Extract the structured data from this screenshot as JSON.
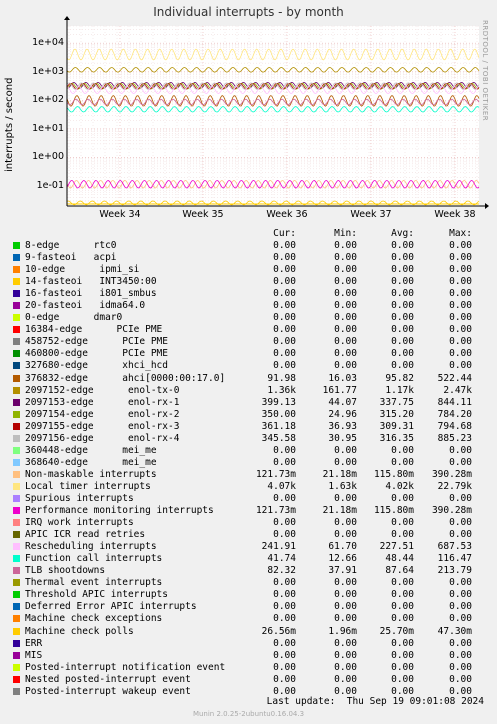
{
  "title": "Individual interrupts - by month",
  "side_label": "RRDTOOL / TOBI OETIKER",
  "footer": "Munin 2.0.25-2ubuntu0.16.04.3",
  "last_update": "Last update:  Thu Sep 19 09:01:08 2024",
  "columns": [
    "Cur:",
    "Min:",
    "Avg:",
    "Max:"
  ],
  "chart_data": {
    "type": "line",
    "ylabel": "interrupts / second",
    "yscale": "log",
    "ylim": [
      0.02,
      40000
    ],
    "yticks": [
      "1e+04",
      "1e+03",
      "1e+02",
      "1e+01",
      "1e+00",
      "1e-01"
    ],
    "x": [
      "Week 34",
      "Week 35",
      "Week 36",
      "Week 37",
      "Week 38"
    ],
    "grid": true,
    "series": [
      {
        "name": "8-edge      rtc0",
        "color": "#00cc00",
        "cur": "0.00",
        "min": "0.00",
        "avg": "0.00",
        "max": "0.00"
      },
      {
        "name": "9-fasteoi   acpi",
        "color": "#0066b3",
        "cur": "0.00",
        "min": "0.00",
        "avg": "0.00",
        "max": "0.00"
      },
      {
        "name": "10-edge      ipmi_si",
        "color": "#ff8000",
        "cur": "0.00",
        "min": "0.00",
        "avg": "0.00",
        "max": "0.00"
      },
      {
        "name": "14-fasteoi   INT3450:00",
        "color": "#ffcc00",
        "cur": "0.00",
        "min": "0.00",
        "avg": "0.00",
        "max": "0.00"
      },
      {
        "name": "16-fasteoi   i801_smbus",
        "color": "#330099",
        "cur": "0.00",
        "min": "0.00",
        "avg": "0.00",
        "max": "0.00"
      },
      {
        "name": "20-fasteoi   idma64.0",
        "color": "#990099",
        "cur": "0.00",
        "min": "0.00",
        "avg": "0.00",
        "max": "0.00"
      },
      {
        "name": "0-edge      dmar0",
        "color": "#ccff00",
        "cur": "0.00",
        "min": "0.00",
        "avg": "0.00",
        "max": "0.00"
      },
      {
        "name": "16384-edge      PCIe PME",
        "color": "#ff0000",
        "cur": "0.00",
        "min": "0.00",
        "avg": "0.00",
        "max": "0.00"
      },
      {
        "name": "458752-edge      PCIe PME",
        "color": "#808080",
        "cur": "0.00",
        "min": "0.00",
        "avg": "0.00",
        "max": "0.00"
      },
      {
        "name": "460800-edge      PCIe PME",
        "color": "#008f00",
        "cur": "0.00",
        "min": "0.00",
        "avg": "0.00",
        "max": "0.00"
      },
      {
        "name": "327680-edge      xhci_hcd",
        "color": "#00487d",
        "cur": "0.00",
        "min": "0.00",
        "avg": "0.00",
        "max": "0.00"
      },
      {
        "name": "376832-edge      ahci[0000:00:17.0]",
        "color": "#b35a00",
        "cur": "91.98",
        "min": "16.03",
        "avg": "95.82",
        "max": "522.44"
      },
      {
        "name": "2097152-edge      enol-tx-0",
        "color": "#b38f00",
        "cur": "1.36k",
        "min": "161.77",
        "avg": "1.17k",
        "max": "2.47k"
      },
      {
        "name": "2097153-edge      enol-rx-1",
        "color": "#6b006b",
        "cur": "399.13",
        "min": "44.07",
        "avg": "337.75",
        "max": "844.11"
      },
      {
        "name": "2097154-edge      enol-rx-2",
        "color": "#8fb300",
        "cur": "350.00",
        "min": "24.96",
        "avg": "315.20",
        "max": "784.20"
      },
      {
        "name": "2097155-edge      enol-rx-3",
        "color": "#b30000",
        "cur": "361.18",
        "min": "36.93",
        "avg": "309.31",
        "max": "794.68"
      },
      {
        "name": "2097156-edge      enol-rx-4",
        "color": "#bebebe",
        "cur": "345.58",
        "min": "30.95",
        "avg": "316.35",
        "max": "885.23"
      },
      {
        "name": "360448-edge      mei_me",
        "color": "#80ff80",
        "cur": "0.00",
        "min": "0.00",
        "avg": "0.00",
        "max": "0.00"
      },
      {
        "name": "368640-edge      mei_me",
        "color": "#80c9ff",
        "cur": "0.00",
        "min": "0.00",
        "avg": "0.00",
        "max": "0.00"
      },
      {
        "name": "Non-maskable interrupts",
        "color": "#ffc080",
        "cur": "121.73m",
        "min": "21.18m",
        "avg": "115.80m",
        "max": "390.28m"
      },
      {
        "name": "Local timer interrupts",
        "color": "#ffe680",
        "cur": "4.07k",
        "min": "1.63k",
        "avg": "4.02k",
        "max": "22.79k"
      },
      {
        "name": "Spurious interrupts",
        "color": "#aa80ff",
        "cur": "0.00",
        "min": "0.00",
        "avg": "0.00",
        "max": "0.00"
      },
      {
        "name": "Performance monitoring interrupts",
        "color": "#ee00cc",
        "cur": "121.73m",
        "min": "21.18m",
        "avg": "115.80m",
        "max": "390.28m"
      },
      {
        "name": "IRQ work interrupts",
        "color": "#ff8080",
        "cur": "0.00",
        "min": "0.00",
        "avg": "0.00",
        "max": "0.00"
      },
      {
        "name": "APIC ICR read retries",
        "color": "#666600",
        "cur": "0.00",
        "min": "0.00",
        "avg": "0.00",
        "max": "0.00"
      },
      {
        "name": "Rescheduling interrupts",
        "color": "#ffbfff",
        "cur": "241.91",
        "min": "61.70",
        "avg": "227.51",
        "max": "687.53"
      },
      {
        "name": "Function call interrupts",
        "color": "#00ffcc",
        "cur": "41.74",
        "min": "12.66",
        "avg": "48.44",
        "max": "116.47"
      },
      {
        "name": "TLB shootdowns",
        "color": "#cc6699",
        "cur": "82.32",
        "min": "37.91",
        "avg": "87.64",
        "max": "213.79"
      },
      {
        "name": "Thermal event interrupts",
        "color": "#999900",
        "cur": "0.00",
        "min": "0.00",
        "avg": "0.00",
        "max": "0.00"
      },
      {
        "name": "Threshold APIC interrupts",
        "color": "#00cc00",
        "cur": "0.00",
        "min": "0.00",
        "avg": "0.00",
        "max": "0.00"
      },
      {
        "name": "Deferred Error APIC interrupts",
        "color": "#0066b3",
        "cur": "0.00",
        "min": "0.00",
        "avg": "0.00",
        "max": "0.00"
      },
      {
        "name": "Machine check exceptions",
        "color": "#ff8000",
        "cur": "0.00",
        "min": "0.00",
        "avg": "0.00",
        "max": "0.00"
      },
      {
        "name": "Machine check polls",
        "color": "#ffcc00",
        "cur": "26.56m",
        "min": "1.96m",
        "avg": "25.70m",
        "max": "47.30m"
      },
      {
        "name": "ERR",
        "color": "#330099",
        "cur": "0.00",
        "min": "0.00",
        "avg": "0.00",
        "max": "0.00"
      },
      {
        "name": "MIS",
        "color": "#990099",
        "cur": "0.00",
        "min": "0.00",
        "avg": "0.00",
        "max": "0.00"
      },
      {
        "name": "Posted-interrupt notification event",
        "color": "#ccff00",
        "cur": "0.00",
        "min": "0.00",
        "avg": "0.00",
        "max": "0.00"
      },
      {
        "name": "Nested posted-interrupt event",
        "color": "#ff0000",
        "cur": "0.00",
        "min": "0.00",
        "avg": "0.00",
        "max": "0.00"
      },
      {
        "name": "Posted-interrupt wakeup event",
        "color": "#808080",
        "cur": "0.00",
        "min": "0.00",
        "avg": "0.00",
        "max": "0.00"
      }
    ]
  }
}
